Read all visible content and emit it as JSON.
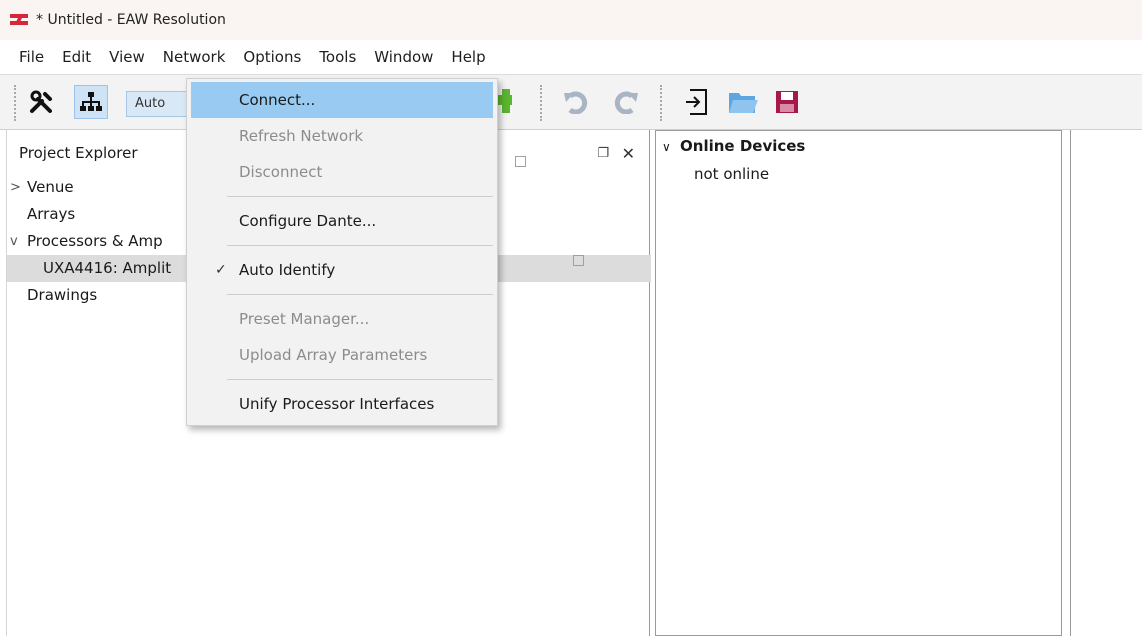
{
  "window": {
    "title": "* Untitled - EAW Resolution"
  },
  "menubar": {
    "items": [
      "File",
      "Edit",
      "View",
      "Network",
      "Options",
      "Tools",
      "Window",
      "Help"
    ]
  },
  "toolbar": {
    "auto_label": "Auto",
    "icons": [
      "tools-icon",
      "network-topology-icon",
      "add-icon",
      "undo-icon",
      "redo-icon",
      "import-icon",
      "open-folder-icon",
      "save-icon"
    ]
  },
  "explorer": {
    "title": "Project Explorer",
    "tree": [
      {
        "label": "Venue",
        "twisty": ">"
      },
      {
        "label": "Arrays",
        "twisty": ""
      },
      {
        "label": "Processors & Amp",
        "twisty": "v"
      },
      {
        "label": "UXA4416: Amplit",
        "twisty": ""
      },
      {
        "label": "Drawings",
        "twisty": ""
      }
    ]
  },
  "online": {
    "title": "Online Devices",
    "status": "not online"
  },
  "network_menu": {
    "items": [
      {
        "label": "Connect...",
        "state": "highlighted"
      },
      {
        "label": "Refresh Network",
        "state": "disabled"
      },
      {
        "label": "Disconnect",
        "state": "disabled"
      },
      {
        "label": "Configure Dante...",
        "state": "enabled"
      },
      {
        "label": "Auto Identify",
        "state": "checked"
      },
      {
        "label": "Preset Manager...",
        "state": "disabled"
      },
      {
        "label": "Upload Array Parameters",
        "state": "disabled"
      },
      {
        "label": "Unify Processor Interfaces",
        "state": "enabled"
      }
    ]
  },
  "colors": {
    "accent": "#99cbf2",
    "logo": "#d2283a",
    "save_icon": "#a8174a"
  }
}
